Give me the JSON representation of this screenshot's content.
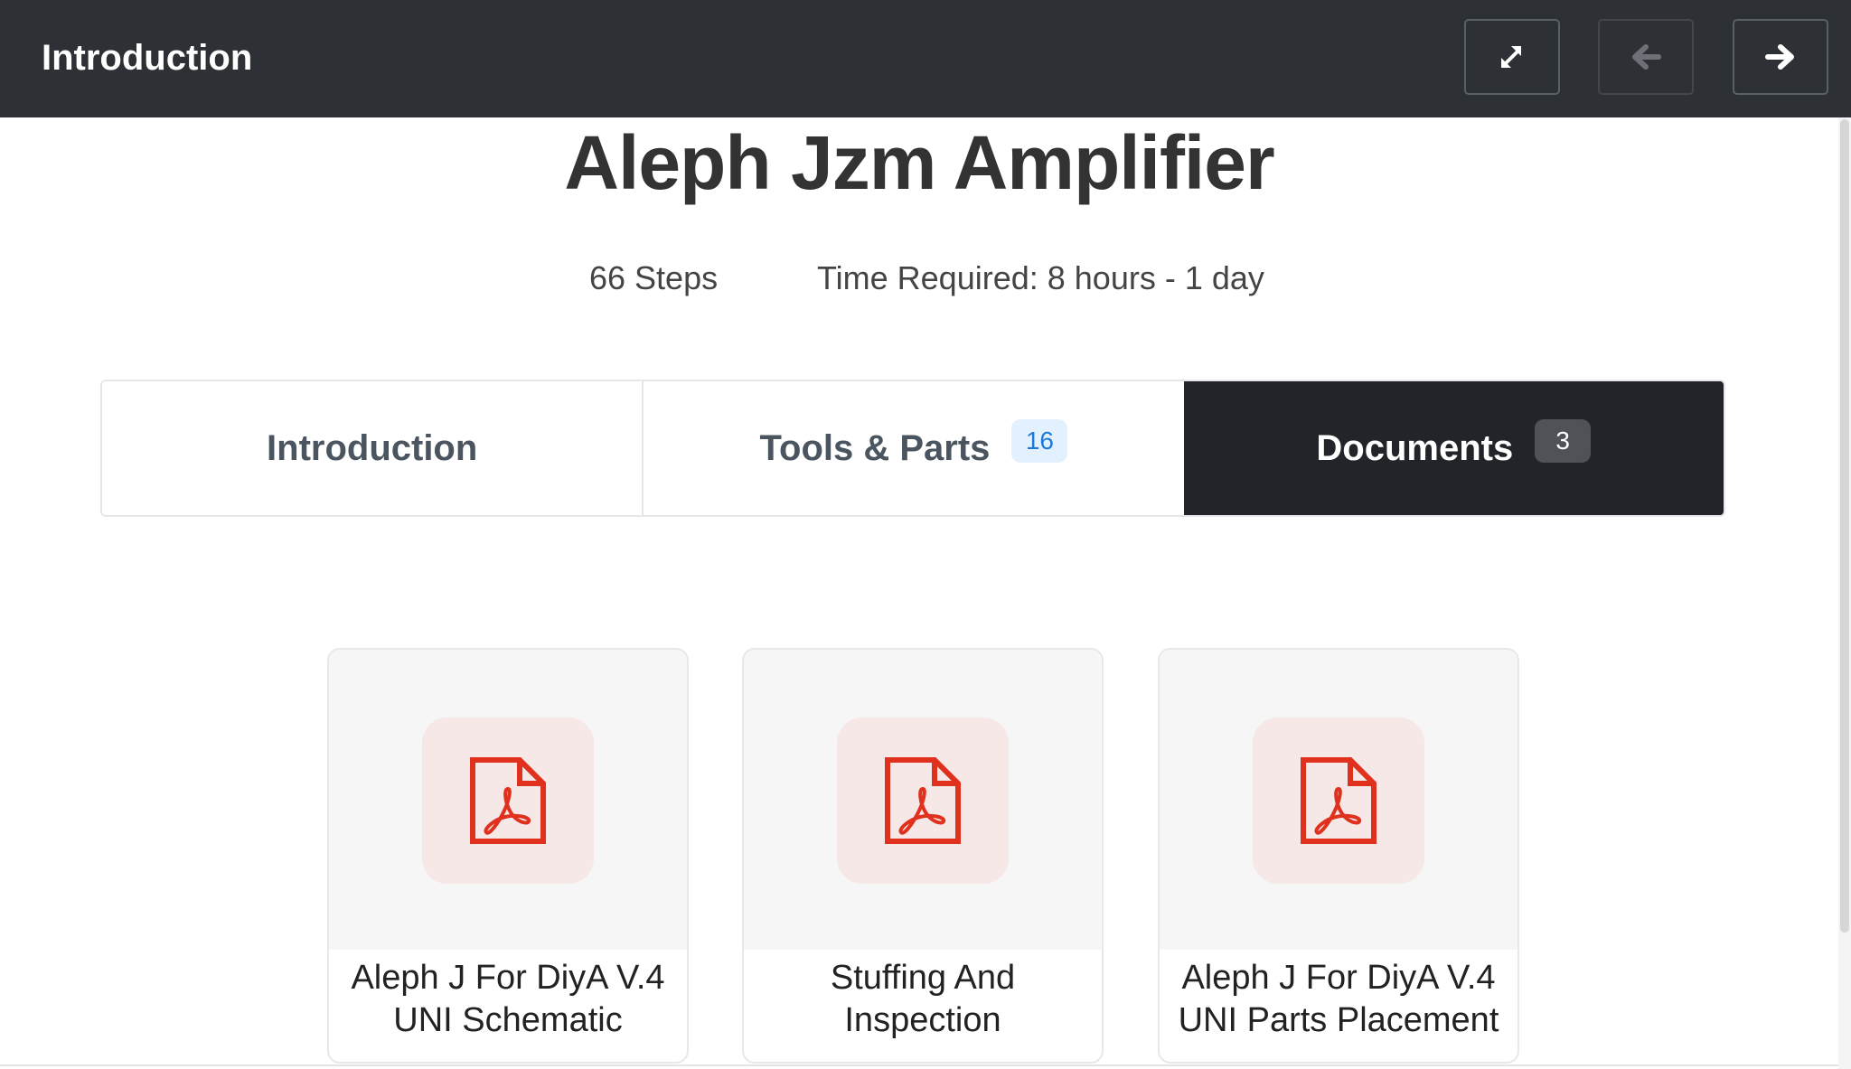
{
  "header": {
    "title": "Introduction",
    "buttons": {
      "fullscreen": {
        "icon": "expand-arrows-icon"
      },
      "previous": {
        "icon": "arrow-left-icon",
        "disabled": true
      },
      "next": {
        "icon": "arrow-right-icon",
        "disabled": false
      }
    }
  },
  "guide": {
    "title": "Aleph Jzm Amplifier",
    "steps": "66 Steps",
    "time_required": "Time Required: 8 hours - 1 day"
  },
  "tabs": [
    {
      "label": "Introduction",
      "active": false
    },
    {
      "label": "Tools & Parts",
      "badge": "16",
      "active": false
    },
    {
      "label": "Documents",
      "badge": "3",
      "active": true
    }
  ],
  "documents": [
    {
      "line1": "Aleph J For DiyA V.4",
      "line2": "UNI Schematic",
      "icon": "pdf-file-icon"
    },
    {
      "line1": "Stuffing And",
      "line2": "Inspection",
      "icon": "pdf-file-icon"
    },
    {
      "line1": "Aleph J For DiyA V.4",
      "line2": "UNI Parts Placement",
      "icon": "pdf-file-icon"
    }
  ],
  "colors": {
    "header_bg": "#2d3135",
    "active_tab_bg": "#212529",
    "pdf_red": "#e0311f",
    "badge_blue_bg": "#e3f0fd",
    "badge_blue_text": "#1f7ad6"
  }
}
